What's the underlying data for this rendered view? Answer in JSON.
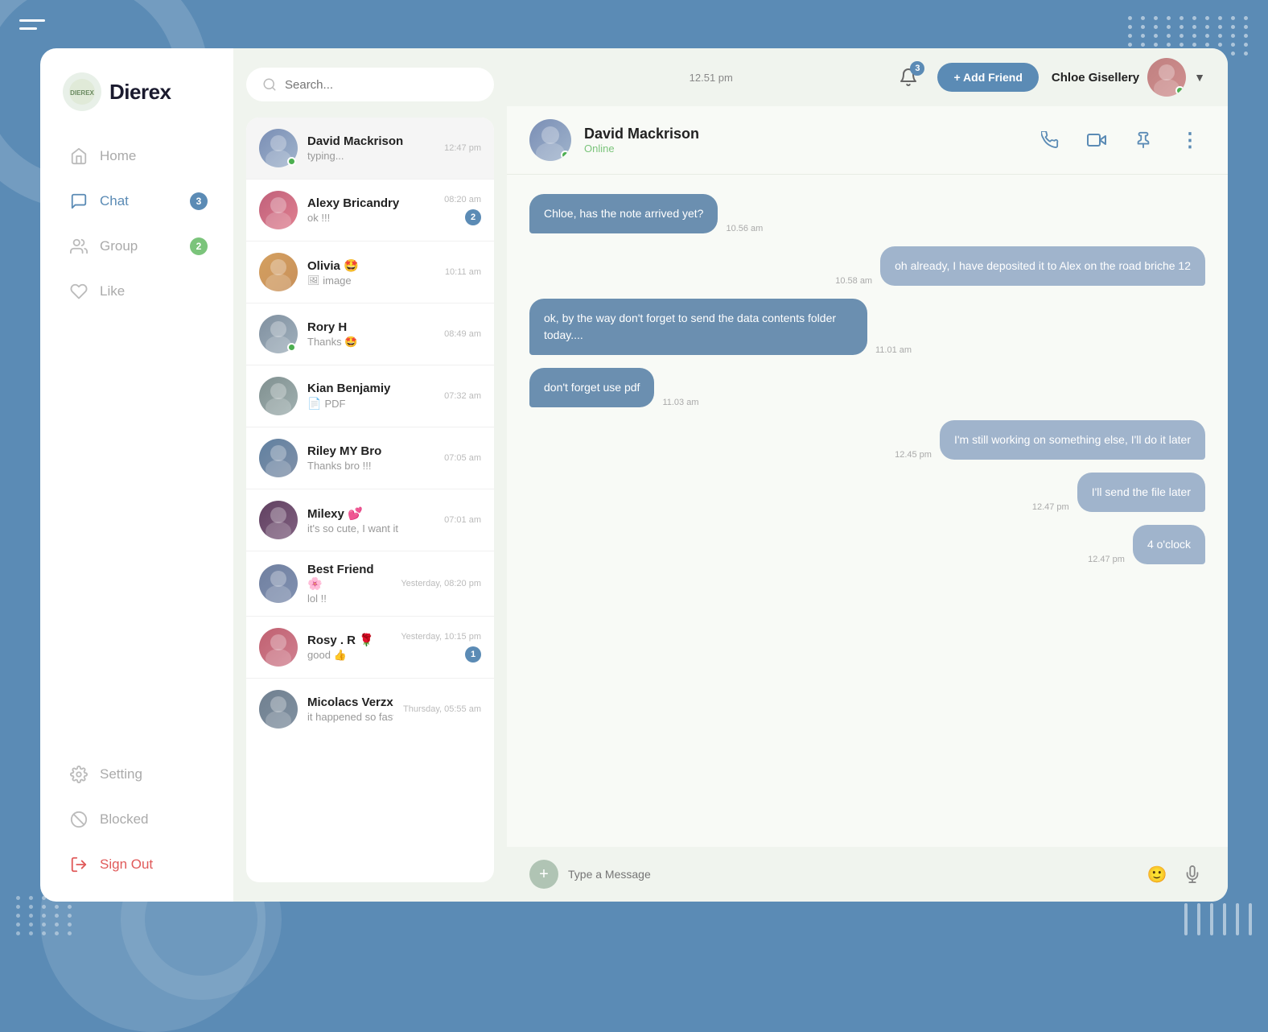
{
  "app": {
    "title": "Dierex",
    "logo_initials": "DIEREX",
    "time": "12.51 pm"
  },
  "sidebar": {
    "nav_items": [
      {
        "id": "home",
        "label": "Home",
        "icon": "home-icon",
        "active": false,
        "badge": null
      },
      {
        "id": "chat",
        "label": "Chat",
        "icon": "chat-icon",
        "active": true,
        "badge": "3"
      },
      {
        "id": "group",
        "label": "Group",
        "icon": "group-icon",
        "active": false,
        "badge": "2"
      },
      {
        "id": "like",
        "label": "Like",
        "icon": "like-icon",
        "active": false,
        "badge": null
      }
    ],
    "bottom_items": [
      {
        "id": "setting",
        "label": "Setting",
        "icon": "setting-icon"
      },
      {
        "id": "blocked",
        "label": "Blocked",
        "icon": "blocked-icon"
      },
      {
        "id": "signout",
        "label": "Sign Out",
        "icon": "signout-icon"
      }
    ]
  },
  "search": {
    "placeholder": "Search..."
  },
  "chat_list": {
    "items": [
      {
        "id": 1,
        "name": "David Mackrison",
        "preview": "typing...",
        "time": "12:47 pm",
        "unread": 0,
        "online": true,
        "avatar_class": "av-david",
        "is_typing": true
      },
      {
        "id": 2,
        "name": "Alexy Bricandry",
        "preview": "ok !!!",
        "time": "08:20 am",
        "unread": 2,
        "online": false,
        "avatar_class": "av-alexy"
      },
      {
        "id": 3,
        "name": "Olivia 🤩",
        "preview": "image",
        "time": "10:11 am",
        "unread": 0,
        "online": false,
        "avatar_class": "av-olivia",
        "preview_icon": "image"
      },
      {
        "id": 4,
        "name": "Rory H",
        "preview": "Thanks 🤩",
        "time": "08:49 am",
        "unread": 0,
        "online": true,
        "avatar_class": "av-rory"
      },
      {
        "id": 5,
        "name": "Kian Benjamiy",
        "preview": "PDF",
        "time": "07:32 am",
        "unread": 0,
        "online": false,
        "avatar_class": "av-kian",
        "preview_icon": "pdf"
      },
      {
        "id": 6,
        "name": "Riley MY Bro",
        "preview": "Thanks bro !!!",
        "time": "07:05 am",
        "unread": 0,
        "online": false,
        "avatar_class": "av-riley"
      },
      {
        "id": 7,
        "name": "Milexy 💕",
        "preview": "it's so cute, I want it",
        "time": "07:01 am",
        "unread": 0,
        "online": false,
        "avatar_class": "av-milexy"
      },
      {
        "id": 8,
        "name": "Best Friend 🌸",
        "preview": "lol !!",
        "time": "Yesterday, 08:20 pm",
        "unread": 0,
        "online": false,
        "avatar_class": "av-bestfriend"
      },
      {
        "id": 9,
        "name": "Rosy . R 🌹",
        "preview": "good 👍",
        "time": "Yesterday, 10:15 pm",
        "unread": 1,
        "online": false,
        "avatar_class": "av-rosy"
      },
      {
        "id": 10,
        "name": "Micolacs Verzx",
        "preview": "it happened so fast...",
        "time": "Thursday, 05:55 am",
        "unread": 0,
        "online": false,
        "avatar_class": "av-micolacs"
      }
    ]
  },
  "active_chat": {
    "name": "David Mackrison",
    "status": "Online",
    "avatar_class": "av-david-large"
  },
  "messages": [
    {
      "id": 1,
      "type": "received",
      "text": "Chloe, has the note arrived yet?",
      "time": "10.56 am"
    },
    {
      "id": 2,
      "type": "sent",
      "text": "oh already, I have deposited it to Alex on the road briche 12",
      "time": "10.58 am"
    },
    {
      "id": 3,
      "type": "received",
      "text": "ok, by the way don't forget to send the data contents folder today....",
      "time": "11.01 am"
    },
    {
      "id": 4,
      "type": "received",
      "text": "don't forget use pdf",
      "time": "11.03 am"
    },
    {
      "id": 5,
      "type": "sent",
      "text": "I'm still working on something else, I'll do it later",
      "time": "12.45 pm"
    },
    {
      "id": 6,
      "type": "sent",
      "text": "I'll send the file later",
      "time": "12.47 pm"
    },
    {
      "id": 7,
      "type": "sent",
      "text": "4 o'clock",
      "time": "12.47 pm"
    }
  ],
  "header": {
    "notification_count": "3",
    "add_friend_label": "+ Add Friend",
    "user_name": "Chloe Gisellery"
  },
  "input": {
    "placeholder": "Type a Message"
  },
  "icons": {
    "search": "🔍",
    "bell": "🔔",
    "phone": "📞",
    "video": "📹",
    "pin": "📌",
    "more": "⋮",
    "emoji": "🙂",
    "mic": "🎙",
    "plus": "+",
    "chevron": "▼",
    "home": "⌂",
    "chat": "💬",
    "group": "👥",
    "like": "♡",
    "setting": "⚙",
    "blocked": "⊘",
    "signout": "→"
  }
}
